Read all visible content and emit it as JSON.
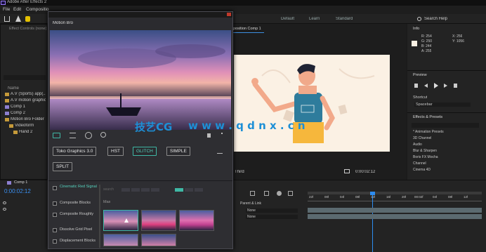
{
  "window": {
    "title": "Adobe After Effects 2"
  },
  "menu": [
    "File",
    "Edit",
    "Compositio"
  ],
  "workspaces": [
    "Default",
    "Learn",
    "Standard"
  ],
  "search_help": "Search Help",
  "left": {
    "effect_controls_tab": "Effect Controls (none)",
    "project_col": "Name",
    "items": [
      "A.V (Sports) app(...)",
      "A.V motion graphic...",
      "Comp 1",
      "Comp 2",
      "Motion Bro Folder",
      "Videoform",
      "Hand 2"
    ],
    "timeline_tab": "Comp 1",
    "timecode": "0:00:02:12"
  },
  "viewer": {
    "tab": "position Comp 1",
    "zoom": "Third",
    "time": "0:00:02:12"
  },
  "right": {
    "info_title": "Info",
    "info_values": [
      "R: 254",
      "G: 250",
      "B: 244",
      "A: 255"
    ],
    "info_coords": [
      "X: 256",
      "Y: 1056"
    ],
    "preview_title": "Preview",
    "shortcut_label": "Shortcut",
    "shortcut_value": "Spacebar",
    "effects_title": "Effects & Presets",
    "effects_items": [
      "* Animation Presets",
      "3D Channel",
      "Audio",
      "Blur & Sharpen",
      "Boris FX Mocha",
      "Channel",
      "Cinema 4D"
    ]
  },
  "timeline": {
    "layer_header": "Parent & Link",
    "parent_values": [
      "None",
      "None"
    ],
    "ruler": [
      "22f",
      "00f",
      "04f",
      "08f",
      "12f",
      "16f",
      "20f",
      "00:02f",
      "04f",
      "08f",
      "12f"
    ]
  },
  "motion_bro": {
    "title": "Motion Bro",
    "filters": [
      "Toko Graphics 3.0",
      "HST",
      "GLITCH",
      "SIMPLE",
      "SPLIT"
    ],
    "active_filter": "GLITCH",
    "categories": [
      "Cinematic Red Signal",
      "Composite Blocks",
      "Composite Roughly",
      "Dissolve Grid Pixel",
      "Displacement Blocks"
    ],
    "section_label": "Max",
    "search_hint": "search"
  },
  "watermark": {
    "left": "技艺CG",
    "right": "w w w . q d n x . c n"
  },
  "colors": {
    "accent": "#3fb8a5",
    "artboard": "#fbf1e4",
    "timeline_blue": "#2d8cf0"
  }
}
